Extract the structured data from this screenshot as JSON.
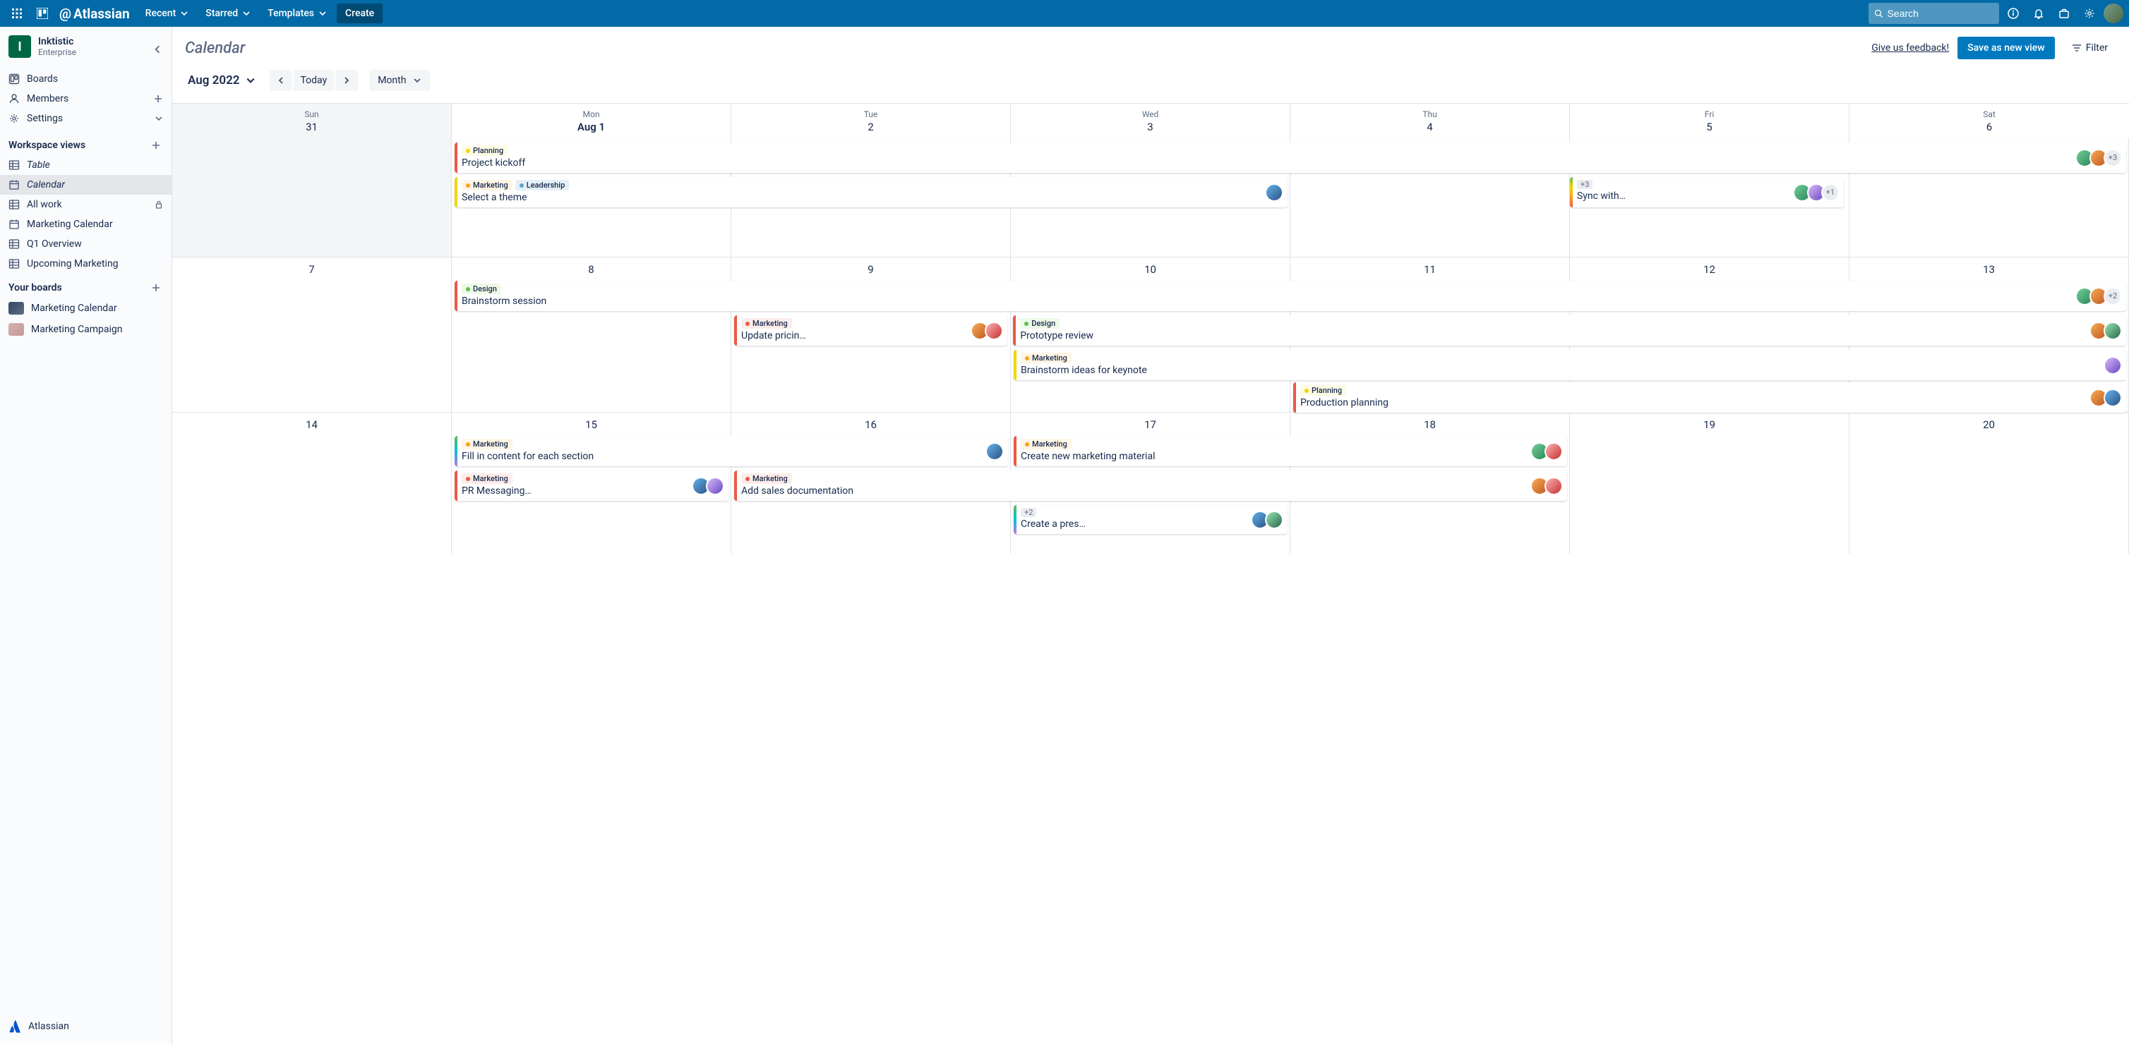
{
  "nav": {
    "brand_prefix": "@",
    "brand": "Atlassian",
    "recent": "Recent",
    "starred": "Starred",
    "templates": "Templates",
    "create": "Create",
    "search_placeholder": "Search"
  },
  "workspace": {
    "initial": "I",
    "name": "Inktistic",
    "plan": "Enterprise"
  },
  "sidebar": {
    "boards": "Boards",
    "members": "Members",
    "settings": "Settings",
    "views_heading": "Workspace views",
    "table": "Table",
    "calendar": "Calendar",
    "all_work": "All work",
    "marketing_calendar": "Marketing Calendar",
    "q1_overview": "Q1 Overview",
    "upcoming_marketing": "Upcoming Marketing",
    "your_boards": "Your boards",
    "board1": "Marketing Calendar",
    "board2": "Marketing Campaign",
    "footer": "Atlassian"
  },
  "page": {
    "title": "Calendar",
    "feedback": "Give us feedback!",
    "save_view": "Save as new view",
    "filter": "Filter"
  },
  "toolbar": {
    "month_label": "Aug 2022",
    "today": "Today",
    "view_mode": "Month"
  },
  "calendar": {
    "day_headers": [
      {
        "dow": "Sun",
        "date": "31",
        "outside": true
      },
      {
        "dow": "Mon",
        "date": "Aug 1"
      },
      {
        "dow": "Tue",
        "date": "2"
      },
      {
        "dow": "Wed",
        "date": "3"
      },
      {
        "dow": "Thu",
        "date": "4"
      },
      {
        "dow": "Fri",
        "date": "5"
      },
      {
        "dow": "Sat",
        "date": "6"
      }
    ],
    "week2_dates": [
      "7",
      "8",
      "9",
      "10",
      "11",
      "12",
      "13"
    ],
    "week3_dates": [
      "14",
      "15",
      "16",
      "17",
      "18",
      "19",
      "20"
    ]
  },
  "events": {
    "kickoff": {
      "title": "Project kickoff",
      "more": "+3"
    },
    "planning_lbl": "Planning",
    "marketing_lbl": "Marketing",
    "leadership_lbl": "Leadership",
    "design_lbl": "Design",
    "select_theme": {
      "title": "Select a theme"
    },
    "sync": {
      "title": "Sync with…",
      "badge": "+3",
      "more": "+1"
    },
    "brainstorm": {
      "title": "Brainstorm session",
      "more": "+2"
    },
    "pricing": {
      "title": "Update pricin…"
    },
    "prototype": {
      "title": "Prototype review"
    },
    "keynote": {
      "title": "Brainstorm ideas for keynote"
    },
    "production": {
      "title": "Production planning"
    },
    "fill_content": {
      "title": "Fill in content for each section"
    },
    "pr_messaging": {
      "title": "PR Messaging…"
    },
    "add_sales": {
      "title": "Add sales documentation"
    },
    "new_marketing": {
      "title": "Create new marketing material"
    },
    "create_pres": {
      "title": "Create a pres…",
      "badge": "+2"
    }
  }
}
